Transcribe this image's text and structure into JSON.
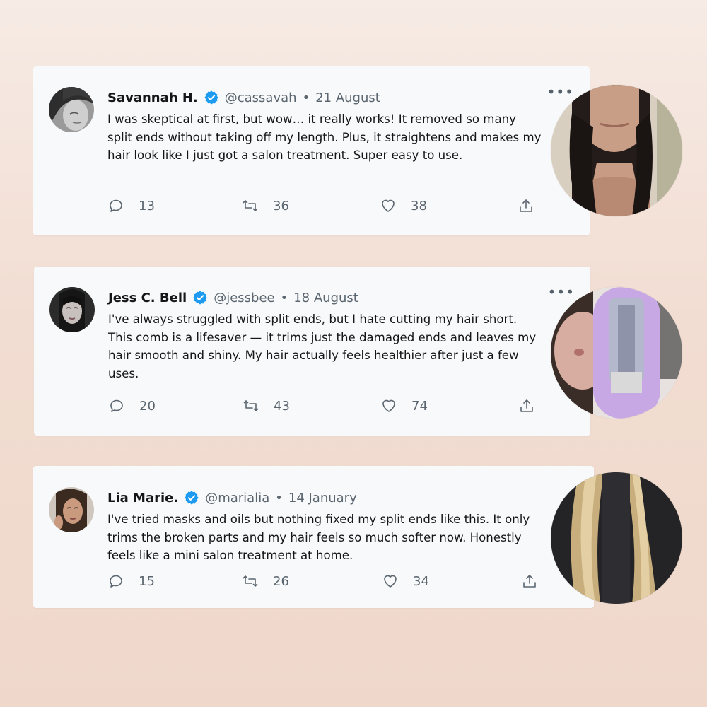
{
  "tweets": [
    {
      "name": "Savannah H.",
      "handle": "@cassavah",
      "date": "21 August",
      "text": "I was skeptical at first, but wow… it really works! It removed so many split ends without taking off my length. Plus, it straightens and makes my hair look like I just got a salon treatment. Super easy to use.",
      "replies": "13",
      "retweets": "36",
      "likes": "38"
    },
    {
      "name": "Jess C. Bell",
      "handle": "@jessbee",
      "date": "18 August",
      "text": "I've always struggled with split ends, but I hate cutting my hair short. This comb is a lifesaver — it trims just the damaged ends and leaves my hair smooth and shiny. My hair actually feels healthier after just a few uses.",
      "replies": "20",
      "retweets": "43",
      "likes": "74"
    },
    {
      "name": "Lia Marie.",
      "handle": "@marialia",
      "date": "14 January",
      "text": "I've tried masks and oils but nothing fixed my split ends like this. It only trims the broken parts and my hair feels so much softer now. Honestly feels like a mini salon treatment at home.",
      "replies": "15",
      "retweets": "26",
      "likes": "34"
    }
  ],
  "separator": "•",
  "more_label": "•••",
  "colors": {
    "verified": "#1d9bf0",
    "text": "#14171a",
    "muted": "#5b6670",
    "card": "#f8f9fa"
  },
  "icons": [
    "verified-badge-icon",
    "reply-icon",
    "retweet-icon",
    "like-icon",
    "share-icon",
    "more-icon"
  ]
}
